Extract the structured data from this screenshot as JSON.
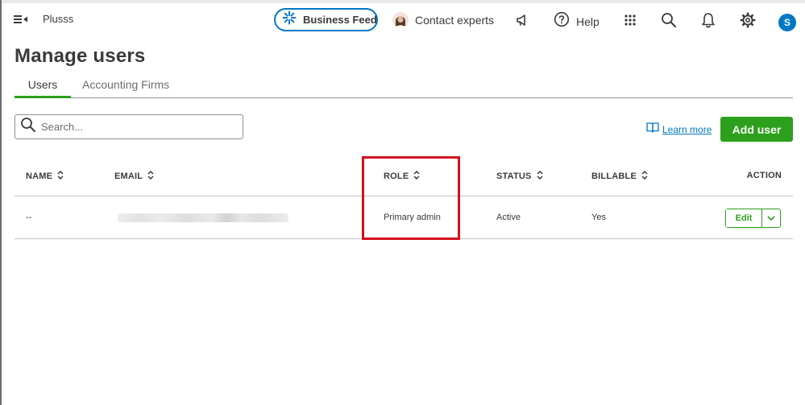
{
  "app": {
    "name": "Plusss"
  },
  "topbar": {
    "business_feed_label": "Business Feed",
    "contact_label": "Contact experts",
    "help_label": "Help",
    "user_initial": "S",
    "icons": [
      "menu-toggle-icon",
      "business-feed-icon",
      "megaphone-icon",
      "help-icon",
      "apps-grid-icon",
      "search-icon",
      "bell-icon",
      "gear-icon"
    ]
  },
  "page": {
    "title": "Manage users"
  },
  "tabs": [
    {
      "label": "Users",
      "active": true
    },
    {
      "label": "Accounting Firms",
      "active": false
    }
  ],
  "search": {
    "placeholder": "Search..."
  },
  "learn_more": {
    "label": "Learn more"
  },
  "add_user": {
    "label": "Add user"
  },
  "table": {
    "columns": [
      "NAME",
      "EMAIL",
      "ROLE",
      "STATUS",
      "BILLABLE",
      "ACTION"
    ],
    "rows": [
      {
        "name": "--",
        "email": "",
        "role": "Primary admin",
        "status": "Active",
        "billable": "Yes",
        "action": "Edit"
      }
    ]
  },
  "colors": {
    "brand_green": "#2ca01c",
    "accent_blue": "#0077c5",
    "highlight_red": "#d4111e",
    "text": "#393a3d"
  }
}
